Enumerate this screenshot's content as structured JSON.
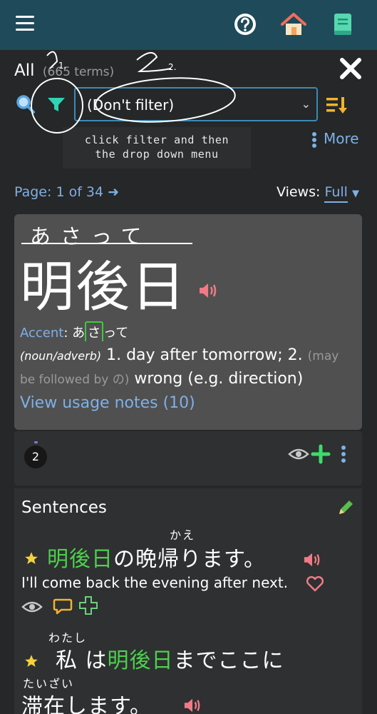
{
  "topbar": {
    "menu_icon": "hamburger-menu-icon",
    "help_icon": "help-circle-icon",
    "home_icon": "home-icon",
    "book_icon": "book-icon"
  },
  "header": {
    "title": "All",
    "count": "(665 terms)"
  },
  "filter": {
    "selected": "(Don't filter)",
    "tooltip_line1": "click filter and then",
    "tooltip_line2": "the drop down menu",
    "more_label": "More"
  },
  "annotations": {
    "mark_1": "1.",
    "mark_2": "2."
  },
  "pagination": {
    "page_label": "Page: 1 of 34",
    "views_label": "Views:",
    "views_value": "Full"
  },
  "term": {
    "furigana": "あさって",
    "kanji": "明後日",
    "accent_label": "Accent",
    "accent_pre": "あ",
    "accent_box": "さ",
    "accent_post": "って",
    "pos": "(noun/adverb)",
    "def_1": "1. day after tomorrow; 2.",
    "def_note": "(may be followed by の)",
    "def_2": "wrong (e.g. direction)",
    "usage_link": "View usage notes (10)"
  },
  "stats": {
    "count": "2"
  },
  "sentences": {
    "title": "Sentences",
    "s1": {
      "furigana": "かえ",
      "highlight": "明後日",
      "rest": "の晩帰ります。",
      "english": "I'll come back the evening after next."
    },
    "s2": {
      "furigana_a": "わたし",
      "furigana_b": "たいざい",
      "pre": "私 は",
      "highlight": "明後日",
      "rest": "までここに",
      "line2": "滞在します。"
    }
  },
  "colors": {
    "topbar": "#1f4a5a",
    "link": "#7fb0e6",
    "highlight_green": "#4cd14c",
    "card_bg": "#505050",
    "speaker_pink": "#f07a86"
  }
}
